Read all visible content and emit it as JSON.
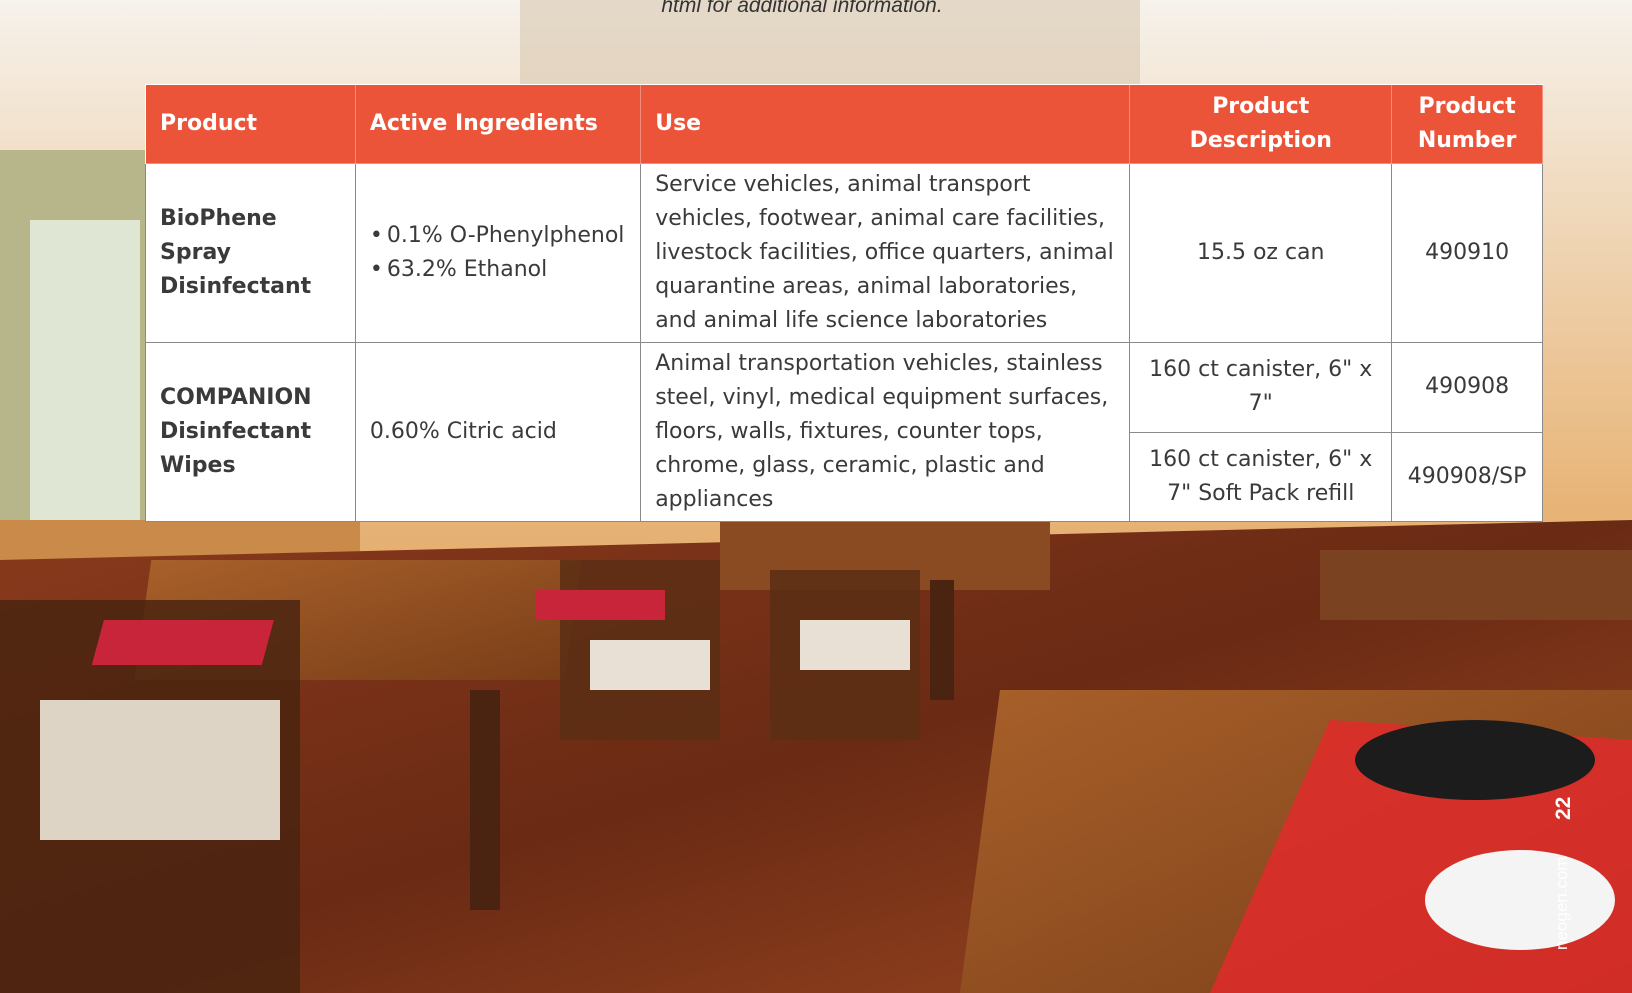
{
  "intro_note": "html for additional information.",
  "table": {
    "headers": {
      "product": "Product",
      "active_ingredients": "Active Ingredients",
      "use": "Use",
      "product_description": "Product Description",
      "product_number": "Product Number"
    },
    "rows": [
      {
        "product": "BioPhene Spray Disinfectant",
        "ingredients": [
          "0.1% O-Phenylphenol",
          "63.2% Ethanol"
        ],
        "use": "Service vehicles, animal transport vehicles, footwear, animal care facilities, livestock facilities, office quarters, animal quarantine areas, animal laboratories, and animal life science laboratories",
        "variants": [
          {
            "description": "15.5 oz can",
            "number": "490910"
          }
        ]
      },
      {
        "product": "COMPANION Disinfectant Wipes",
        "ingredients_text": "0.60% Citric acid",
        "use": "Animal transportation vehicles, stainless steel, vinyl, medical equipment surfaces, floors, walls, fixtures, counter tops, chrome, glass, ceramic, plastic and appliances",
        "variants": [
          {
            "description": "160 ct canister, 6\" x 7\"",
            "number": "490908"
          },
          {
            "description": "160 ct canister, 6\" x 7\" Soft Pack refill",
            "number": "490908/SP"
          }
        ]
      }
    ]
  },
  "footer": {
    "website": "neogen.com",
    "page_number": "22"
  }
}
